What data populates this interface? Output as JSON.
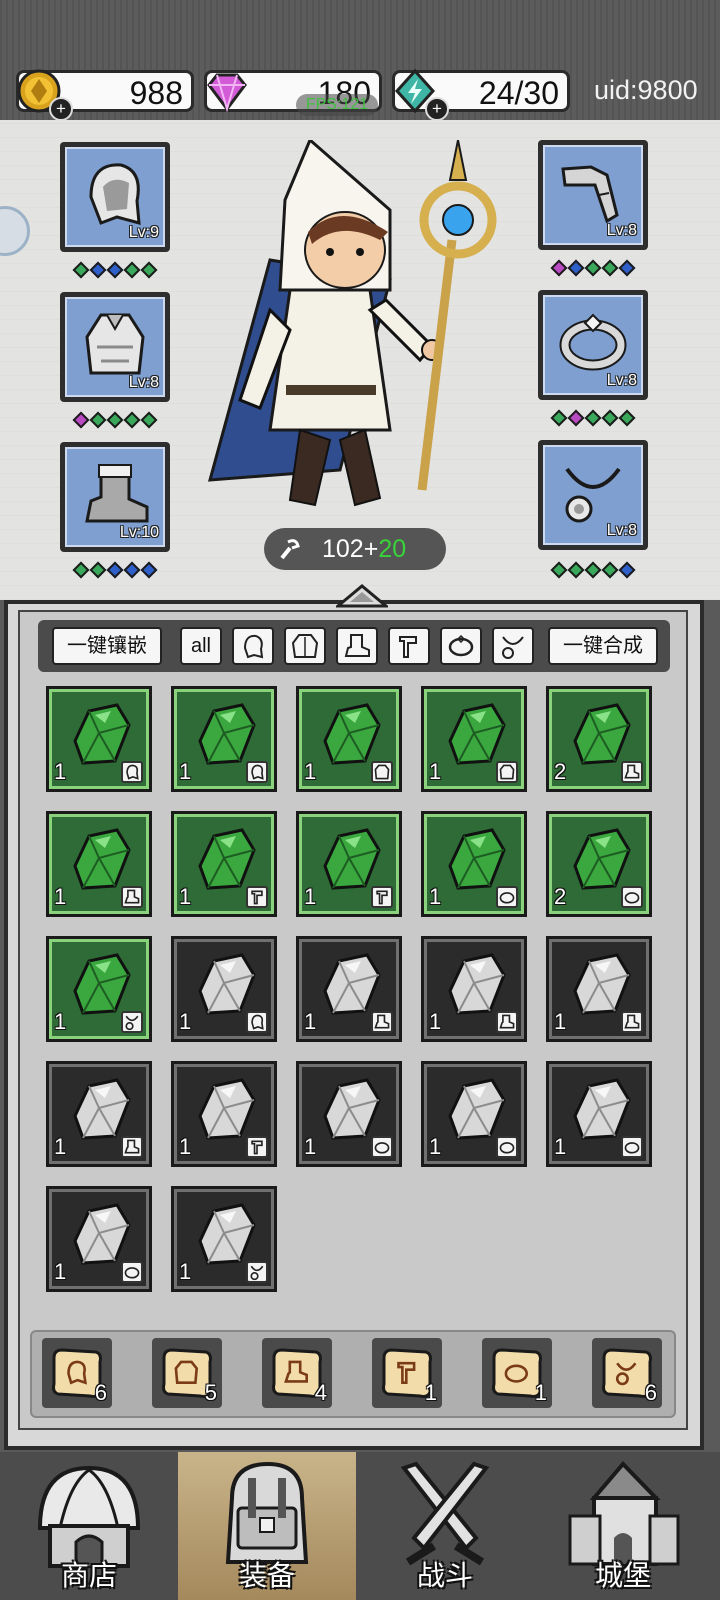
{
  "resources": {
    "gold": "988",
    "diamond": "180",
    "energy": "24/30",
    "uid": "uid:9800",
    "fps": "FPS:121"
  },
  "hero": {
    "power_base": "102+",
    "power_bonus": "20",
    "equipment": [
      {
        "slot": "helmet",
        "level": "Lv:9"
      },
      {
        "slot": "armor",
        "level": "Lv:8"
      },
      {
        "slot": "boots",
        "level": "Lv:10"
      },
      {
        "slot": "bracer",
        "level": "Lv:8"
      },
      {
        "slot": "ring",
        "level": "Lv:8"
      },
      {
        "slot": "necklace",
        "level": "Lv:8"
      }
    ]
  },
  "filters": {
    "inlay_all": "一键镶嵌",
    "all": "all",
    "merge_all": "一键合成"
  },
  "gems": [
    {
      "type": "green",
      "qty": "1",
      "slot_icon": "helmet-icon"
    },
    {
      "type": "green",
      "qty": "1",
      "slot_icon": "helmet-icon"
    },
    {
      "type": "green",
      "qty": "1",
      "slot_icon": "armor-icon"
    },
    {
      "type": "green",
      "qty": "1",
      "slot_icon": "armor-icon"
    },
    {
      "type": "green",
      "qty": "2",
      "slot_icon": "boots-icon"
    },
    {
      "type": "green",
      "qty": "1",
      "slot_icon": "boots-icon"
    },
    {
      "type": "green",
      "qty": "1",
      "slot_icon": "weapon-icon"
    },
    {
      "type": "green",
      "qty": "1",
      "slot_icon": "weapon-icon"
    },
    {
      "type": "green",
      "qty": "1",
      "slot_icon": "ring-icon"
    },
    {
      "type": "green",
      "qty": "2",
      "slot_icon": "ring-icon"
    },
    {
      "type": "green",
      "qty": "1",
      "slot_icon": "necklace-icon"
    },
    {
      "type": "gray",
      "qty": "1",
      "slot_icon": "helmet-icon"
    },
    {
      "type": "gray",
      "qty": "1",
      "slot_icon": "boots-icon"
    },
    {
      "type": "gray",
      "qty": "1",
      "slot_icon": "boots-icon"
    },
    {
      "type": "gray",
      "qty": "1",
      "slot_icon": "boots-icon"
    },
    {
      "type": "gray",
      "qty": "1",
      "slot_icon": "boots-icon"
    },
    {
      "type": "gray",
      "qty": "1",
      "slot_icon": "weapon-icon"
    },
    {
      "type": "gray",
      "qty": "1",
      "slot_icon": "ring-icon"
    },
    {
      "type": "gray",
      "qty": "1",
      "slot_icon": "ring-icon"
    },
    {
      "type": "gray",
      "qty": "1",
      "slot_icon": "ring-icon"
    },
    {
      "type": "gray",
      "qty": "1",
      "slot_icon": "ring-icon"
    },
    {
      "type": "gray",
      "qty": "1",
      "slot_icon": "necklace-icon"
    }
  ],
  "scrolls": [
    {
      "icon": "helmet-icon",
      "count": "6"
    },
    {
      "icon": "armor-icon",
      "count": "5"
    },
    {
      "icon": "boots-icon",
      "count": "4"
    },
    {
      "icon": "weapon-icon",
      "count": "1"
    },
    {
      "icon": "ring-icon",
      "count": "1"
    },
    {
      "icon": "necklace-icon",
      "count": "6"
    }
  ],
  "nav": {
    "shop": "商店",
    "equipment": "装备",
    "battle": "战斗",
    "castle": "城堡"
  },
  "colors": {
    "green_gem": "#3aa83e",
    "gray_gem": "#d8d8d8",
    "nav_active": "#c9b48a"
  }
}
